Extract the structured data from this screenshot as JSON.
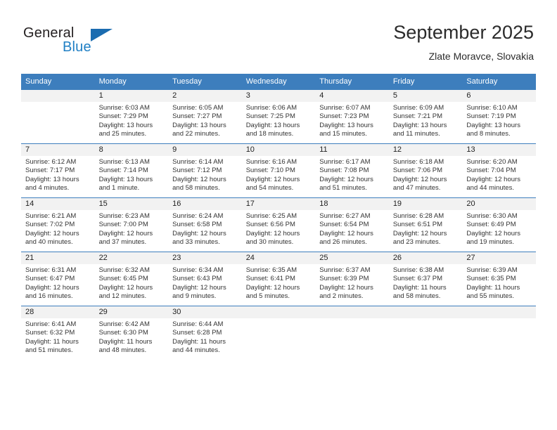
{
  "brand": {
    "word1": "General",
    "word2": "Blue",
    "logo_icon": "triangle-logo-icon",
    "accent_color": "#1b6cb0"
  },
  "header": {
    "title": "September 2025",
    "subtitle": "Zlate Moravce, Slovakia"
  },
  "theme": {
    "header_row_bg": "#3d7ebd",
    "daynum_band_bg": "#f2f2f2",
    "text_color": "#333333"
  },
  "weekday_headers": [
    "Sunday",
    "Monday",
    "Tuesday",
    "Wednesday",
    "Thursday",
    "Friday",
    "Saturday"
  ],
  "weeks": [
    [
      {
        "day": "",
        "blank": true,
        "sunrise": "",
        "sunset": "",
        "daylight1": "",
        "daylight2": ""
      },
      {
        "day": "1",
        "sunrise": "Sunrise: 6:03 AM",
        "sunset": "Sunset: 7:29 PM",
        "daylight1": "Daylight: 13 hours",
        "daylight2": "and 25 minutes."
      },
      {
        "day": "2",
        "sunrise": "Sunrise: 6:05 AM",
        "sunset": "Sunset: 7:27 PM",
        "daylight1": "Daylight: 13 hours",
        "daylight2": "and 22 minutes."
      },
      {
        "day": "3",
        "sunrise": "Sunrise: 6:06 AM",
        "sunset": "Sunset: 7:25 PM",
        "daylight1": "Daylight: 13 hours",
        "daylight2": "and 18 minutes."
      },
      {
        "day": "4",
        "sunrise": "Sunrise: 6:07 AM",
        "sunset": "Sunset: 7:23 PM",
        "daylight1": "Daylight: 13 hours",
        "daylight2": "and 15 minutes."
      },
      {
        "day": "5",
        "sunrise": "Sunrise: 6:09 AM",
        "sunset": "Sunset: 7:21 PM",
        "daylight1": "Daylight: 13 hours",
        "daylight2": "and 11 minutes."
      },
      {
        "day": "6",
        "sunrise": "Sunrise: 6:10 AM",
        "sunset": "Sunset: 7:19 PM",
        "daylight1": "Daylight: 13 hours",
        "daylight2": "and 8 minutes."
      }
    ],
    [
      {
        "day": "7",
        "sunrise": "Sunrise: 6:12 AM",
        "sunset": "Sunset: 7:17 PM",
        "daylight1": "Daylight: 13 hours",
        "daylight2": "and 4 minutes."
      },
      {
        "day": "8",
        "sunrise": "Sunrise: 6:13 AM",
        "sunset": "Sunset: 7:14 PM",
        "daylight1": "Daylight: 13 hours",
        "daylight2": "and 1 minute."
      },
      {
        "day": "9",
        "sunrise": "Sunrise: 6:14 AM",
        "sunset": "Sunset: 7:12 PM",
        "daylight1": "Daylight: 12 hours",
        "daylight2": "and 58 minutes."
      },
      {
        "day": "10",
        "sunrise": "Sunrise: 6:16 AM",
        "sunset": "Sunset: 7:10 PM",
        "daylight1": "Daylight: 12 hours",
        "daylight2": "and 54 minutes."
      },
      {
        "day": "11",
        "sunrise": "Sunrise: 6:17 AM",
        "sunset": "Sunset: 7:08 PM",
        "daylight1": "Daylight: 12 hours",
        "daylight2": "and 51 minutes."
      },
      {
        "day": "12",
        "sunrise": "Sunrise: 6:18 AM",
        "sunset": "Sunset: 7:06 PM",
        "daylight1": "Daylight: 12 hours",
        "daylight2": "and 47 minutes."
      },
      {
        "day": "13",
        "sunrise": "Sunrise: 6:20 AM",
        "sunset": "Sunset: 7:04 PM",
        "daylight1": "Daylight: 12 hours",
        "daylight2": "and 44 minutes."
      }
    ],
    [
      {
        "day": "14",
        "sunrise": "Sunrise: 6:21 AM",
        "sunset": "Sunset: 7:02 PM",
        "daylight1": "Daylight: 12 hours",
        "daylight2": "and 40 minutes."
      },
      {
        "day": "15",
        "sunrise": "Sunrise: 6:23 AM",
        "sunset": "Sunset: 7:00 PM",
        "daylight1": "Daylight: 12 hours",
        "daylight2": "and 37 minutes."
      },
      {
        "day": "16",
        "sunrise": "Sunrise: 6:24 AM",
        "sunset": "Sunset: 6:58 PM",
        "daylight1": "Daylight: 12 hours",
        "daylight2": "and 33 minutes."
      },
      {
        "day": "17",
        "sunrise": "Sunrise: 6:25 AM",
        "sunset": "Sunset: 6:56 PM",
        "daylight1": "Daylight: 12 hours",
        "daylight2": "and 30 minutes."
      },
      {
        "day": "18",
        "sunrise": "Sunrise: 6:27 AM",
        "sunset": "Sunset: 6:54 PM",
        "daylight1": "Daylight: 12 hours",
        "daylight2": "and 26 minutes."
      },
      {
        "day": "19",
        "sunrise": "Sunrise: 6:28 AM",
        "sunset": "Sunset: 6:51 PM",
        "daylight1": "Daylight: 12 hours",
        "daylight2": "and 23 minutes."
      },
      {
        "day": "20",
        "sunrise": "Sunrise: 6:30 AM",
        "sunset": "Sunset: 6:49 PM",
        "daylight1": "Daylight: 12 hours",
        "daylight2": "and 19 minutes."
      }
    ],
    [
      {
        "day": "21",
        "sunrise": "Sunrise: 6:31 AM",
        "sunset": "Sunset: 6:47 PM",
        "daylight1": "Daylight: 12 hours",
        "daylight2": "and 16 minutes."
      },
      {
        "day": "22",
        "sunrise": "Sunrise: 6:32 AM",
        "sunset": "Sunset: 6:45 PM",
        "daylight1": "Daylight: 12 hours",
        "daylight2": "and 12 minutes."
      },
      {
        "day": "23",
        "sunrise": "Sunrise: 6:34 AM",
        "sunset": "Sunset: 6:43 PM",
        "daylight1": "Daylight: 12 hours",
        "daylight2": "and 9 minutes."
      },
      {
        "day": "24",
        "sunrise": "Sunrise: 6:35 AM",
        "sunset": "Sunset: 6:41 PM",
        "daylight1": "Daylight: 12 hours",
        "daylight2": "and 5 minutes."
      },
      {
        "day": "25",
        "sunrise": "Sunrise: 6:37 AM",
        "sunset": "Sunset: 6:39 PM",
        "daylight1": "Daylight: 12 hours",
        "daylight2": "and 2 minutes."
      },
      {
        "day": "26",
        "sunrise": "Sunrise: 6:38 AM",
        "sunset": "Sunset: 6:37 PM",
        "daylight1": "Daylight: 11 hours",
        "daylight2": "and 58 minutes."
      },
      {
        "day": "27",
        "sunrise": "Sunrise: 6:39 AM",
        "sunset": "Sunset: 6:35 PM",
        "daylight1": "Daylight: 11 hours",
        "daylight2": "and 55 minutes."
      }
    ],
    [
      {
        "day": "28",
        "sunrise": "Sunrise: 6:41 AM",
        "sunset": "Sunset: 6:32 PM",
        "daylight1": "Daylight: 11 hours",
        "daylight2": "and 51 minutes."
      },
      {
        "day": "29",
        "sunrise": "Sunrise: 6:42 AM",
        "sunset": "Sunset: 6:30 PM",
        "daylight1": "Daylight: 11 hours",
        "daylight2": "and 48 minutes."
      },
      {
        "day": "30",
        "sunrise": "Sunrise: 6:44 AM",
        "sunset": "Sunset: 6:28 PM",
        "daylight1": "Daylight: 11 hours",
        "daylight2": "and 44 minutes."
      },
      {
        "day": "",
        "blank": true,
        "sunrise": "",
        "sunset": "",
        "daylight1": "",
        "daylight2": ""
      },
      {
        "day": "",
        "blank": true,
        "sunrise": "",
        "sunset": "",
        "daylight1": "",
        "daylight2": ""
      },
      {
        "day": "",
        "blank": true,
        "sunrise": "",
        "sunset": "",
        "daylight1": "",
        "daylight2": ""
      },
      {
        "day": "",
        "blank": true,
        "sunrise": "",
        "sunset": "",
        "daylight1": "",
        "daylight2": ""
      }
    ]
  ]
}
